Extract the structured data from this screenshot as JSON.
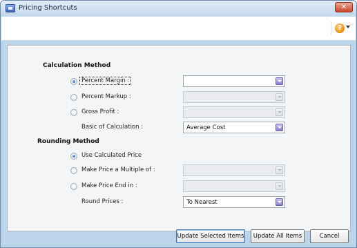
{
  "window": {
    "title": "Pricing Shortcuts",
    "close_label": "✕"
  },
  "toolbar": {
    "help_glyph": "?"
  },
  "calculation": {
    "heading": "Calculation Method",
    "options": [
      {
        "label": "Percent Margin :",
        "checked": true,
        "value": ""
      },
      {
        "label": "Percent Markup :",
        "checked": false,
        "value": ""
      },
      {
        "label": "Gross Profit :",
        "checked": false,
        "value": ""
      }
    ],
    "basis": {
      "label": "Basic of Calculation :",
      "value": "Average Cost"
    }
  },
  "rounding": {
    "heading": "Rounding Method",
    "options": [
      {
        "label": "Use Calculated Price",
        "checked": true
      },
      {
        "label": "Make Price a Multiple of :",
        "checked": false,
        "value": ""
      },
      {
        "label": "Make Price End in :",
        "checked": false,
        "value": ""
      }
    ],
    "round_prices": {
      "label": "Round Prices :",
      "value": "To Nearest"
    }
  },
  "buttons": {
    "update_selected": "Update Selected Items",
    "update_all": "Update All Items",
    "cancel": "Cancel"
  },
  "icons": {
    "app": "app-icon",
    "close": "close-icon",
    "help": "help-icon",
    "dropdown": "chevron-down-icon",
    "radio": "radio-icon"
  }
}
